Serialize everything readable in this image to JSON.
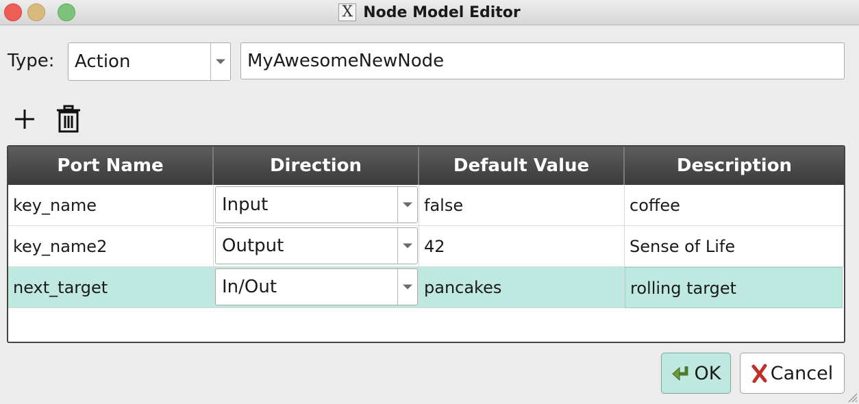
{
  "window": {
    "title": "Node Model Editor",
    "icon": "x11-icon"
  },
  "type_row": {
    "label": "Type:",
    "type_value": "Action",
    "name_value": "MyAwesomeNewNode"
  },
  "toolbar": {
    "add_icon": "plus-icon",
    "delete_icon": "trash-icon"
  },
  "table": {
    "headers": [
      "Port Name",
      "Direction",
      "Default Value",
      "Description"
    ],
    "rows": [
      {
        "port_name": "key_name",
        "direction": "Input",
        "default_value": "false",
        "description": "coffee"
      },
      {
        "port_name": "key_name2",
        "direction": "Output",
        "default_value": "42",
        "description": "Sense of Life"
      },
      {
        "port_name": "next_target",
        "direction": "In/Out",
        "default_value": "pancakes",
        "description": "rolling target",
        "selected": true
      }
    ]
  },
  "buttons": {
    "ok_label": "OK",
    "cancel_label": "Cancel"
  },
  "colors": {
    "selection": "#bfe9e0",
    "header_bg": "#444444",
    "close": "#ee5e57",
    "minimize": "#d8ba7f",
    "maximize": "#7dc27a"
  }
}
